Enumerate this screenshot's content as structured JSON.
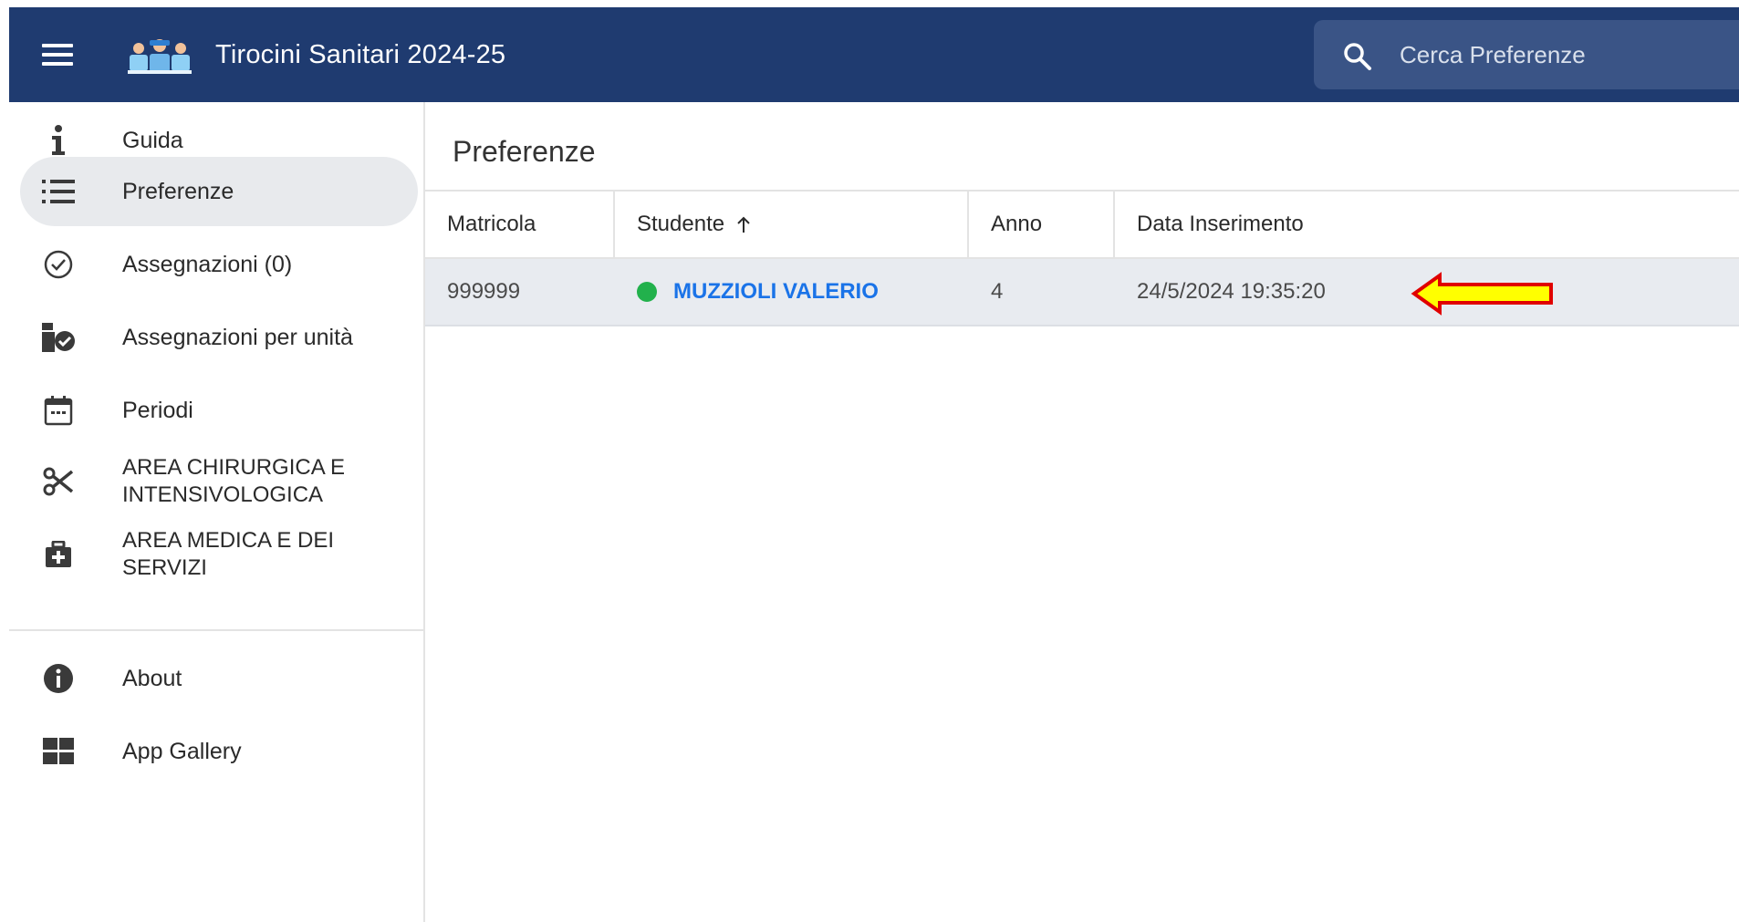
{
  "header": {
    "app_title": "Tirocini Sanitari 2024-25",
    "logo_icon": "medical-staff-logo-icon",
    "menu_icon": "hamburger-menu-icon",
    "search": {
      "placeholder": "Cerca Preferenze",
      "value": "",
      "icon": "search-icon"
    }
  },
  "sidebar": {
    "items": [
      {
        "label": "Guida",
        "icon": "info-icon",
        "active": false
      },
      {
        "label": "Preferenze",
        "icon": "list-icon",
        "active": true
      },
      {
        "label": "Assegnazioni (0)",
        "icon": "check-circle-icon",
        "active": false
      },
      {
        "label": "Assegnazioni per unità",
        "icon": "unit-check-icon",
        "active": false
      },
      {
        "label": "Periodi",
        "icon": "calendar-icon",
        "active": false
      },
      {
        "label": "AREA CHIRURGICA E INTENSIVOLOGICA",
        "icon": "scissors-icon",
        "active": false
      },
      {
        "label": "AREA MEDICA E DEI SERVIZI",
        "icon": "medical-kit-icon",
        "active": false
      },
      {
        "label": "About",
        "icon": "info-filled-icon",
        "active": false
      },
      {
        "label": "App Gallery",
        "icon": "grid-icon",
        "active": false
      }
    ]
  },
  "main": {
    "page_title": "Preferenze",
    "table": {
      "columns": [
        "Matricola",
        "Studente",
        "Anno",
        "Data Inserimento"
      ],
      "sorted_column": "Studente",
      "sort_direction": "ascending",
      "rows": [
        {
          "matricola": "999999",
          "studente": "MUZZIOLI VALERIO",
          "status_color": "#22b14c",
          "anno": "4",
          "data_inserimento": "24/5/2024 19:35:20"
        }
      ]
    },
    "annotation_icon": "yellow-arrow-pointer-icon"
  },
  "colors": {
    "header_bg": "#1f3b70",
    "search_bg": "#3a5486",
    "active_nav_bg": "#e8eaed",
    "row_bg": "#e8ebf0",
    "link": "#1a73e8",
    "status_green": "#22b14c",
    "arrow_fill": "#ffff00",
    "arrow_stroke": "#e00000"
  }
}
